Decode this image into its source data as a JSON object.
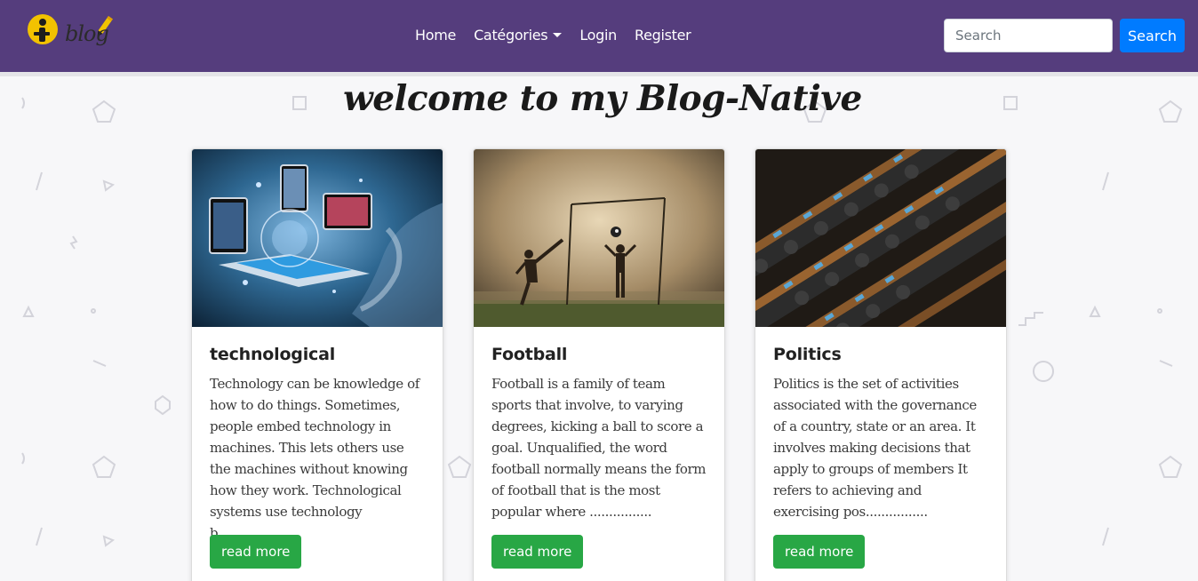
{
  "brand": {
    "logo_text": "blog"
  },
  "nav": {
    "items": [
      {
        "label": "Home"
      },
      {
        "label": "Catégories"
      },
      {
        "label": "Login"
      },
      {
        "label": "Register"
      }
    ]
  },
  "search": {
    "placeholder": "Search",
    "value": "",
    "button_label": "Search"
  },
  "page": {
    "title": "welcome to my Blog-Native"
  },
  "cards": [
    {
      "title": "technological",
      "text": "Technology can be knowledge of how to do things. Sometimes, people embed technology in machines. This lets others use the machines without knowing how they work. Technological systems use technology b................",
      "button": "read more",
      "image_icon": "technology-image"
    },
    {
      "title": "Football",
      "text": "Football is a family of team sports that involve, to varying degrees, kicking a ball to score a goal. Unqualified, the word football normally means the form of football that is the most popular where ................",
      "button": "read more",
      "image_icon": "football-image"
    },
    {
      "title": "Politics",
      "text": "Politics is the set of activities associated with the governance of a country, state or an area. It involves making decisions that apply to groups of members It refers to achieving and exercising pos................",
      "button": "read more",
      "image_icon": "parliament-image"
    }
  ],
  "colors": {
    "navbar": "#553d7d",
    "search_button": "#007bff",
    "read_more_button": "#28a745",
    "background": "#f7f7f9"
  }
}
